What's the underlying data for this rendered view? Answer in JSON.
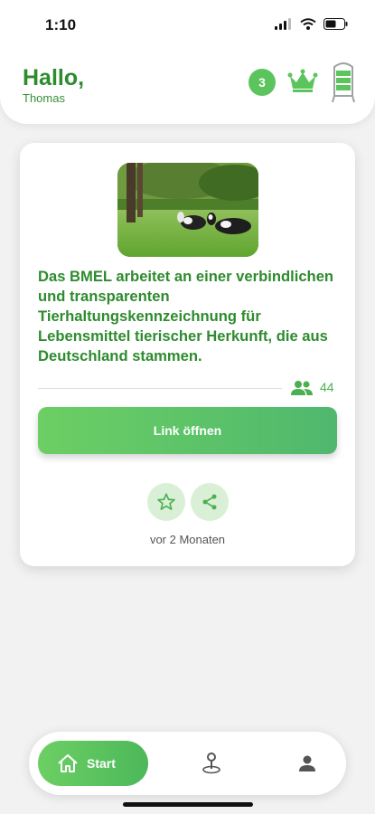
{
  "status_bar": {
    "time": "1:10",
    "icons": [
      "cellular-signal-icon",
      "wifi-icon",
      "battery-icon"
    ]
  },
  "header": {
    "greeting": "Hallo,",
    "username": "Thomas",
    "badge_count": "3",
    "icons": [
      "crown-icon",
      "silo-icon"
    ]
  },
  "post": {
    "image": "cows-in-meadow",
    "headline": "Das BMEL arbeitet an einer verbindlichen und transparenten Tierhaltungskennzeichnung für Lebensmittel tierischer Herkunft, die aus Deutschland stammen.",
    "viewer_count": "44",
    "link_button_label": "Link öffnen",
    "actions": [
      "star-icon",
      "share-icon"
    ],
    "timestamp": "vor 2 Monaten"
  },
  "bottom_nav": {
    "items": [
      {
        "label": "Start",
        "icon": "home-icon",
        "active": true
      },
      {
        "label": "",
        "icon": "map-pin-icon",
        "active": false
      },
      {
        "label": "",
        "icon": "person-icon",
        "active": false
      }
    ]
  },
  "colors": {
    "accent": "#4caf50",
    "text_green": "#2e8b2e",
    "background": "#f2f2f2",
    "card": "#ffffff"
  }
}
